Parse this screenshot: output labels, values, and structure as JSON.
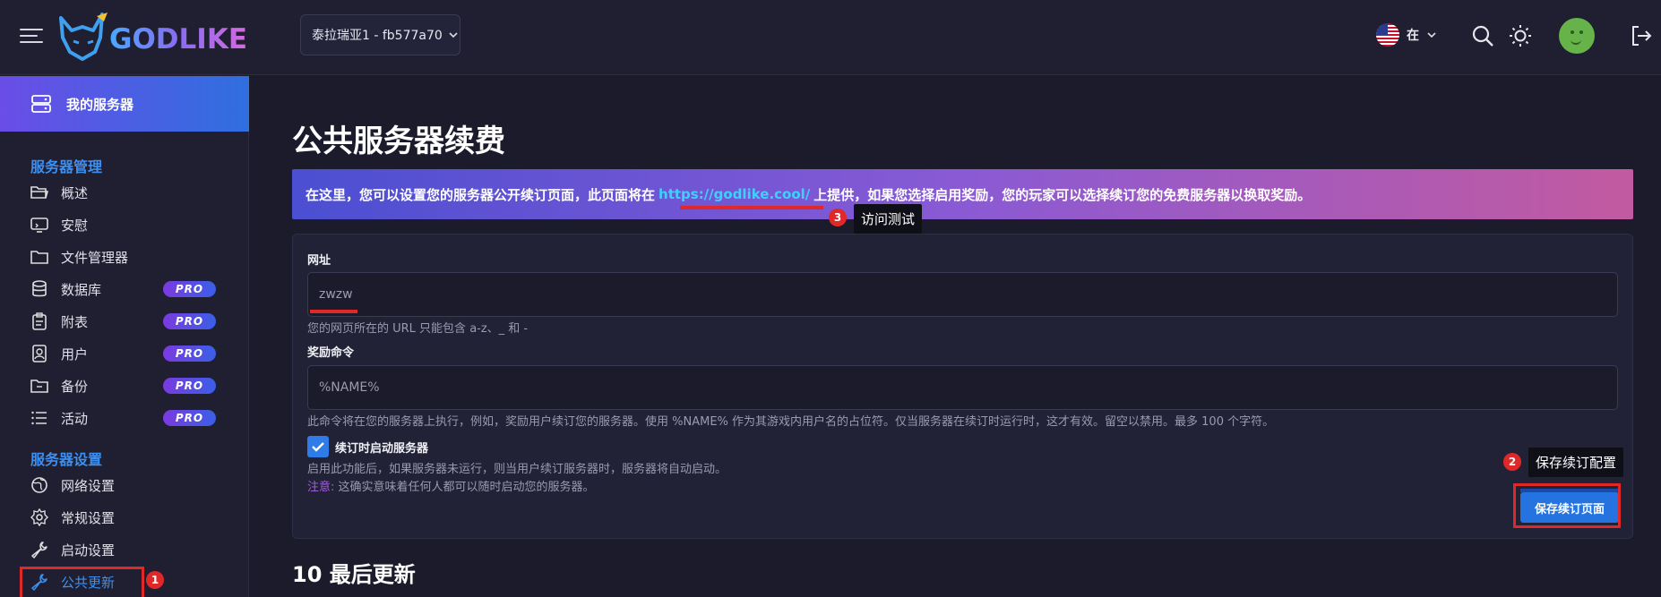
{
  "header": {
    "brand": "GODLIKE",
    "server_selector": "泰拉瑞亚1 - fb577a70",
    "language": "在"
  },
  "sidebar": {
    "my_servers": "我的服务器",
    "management_title": "服务器管理",
    "management_items": [
      {
        "label": "概述",
        "icon": "folder-open-icon",
        "pro": ""
      },
      {
        "label": "安慰",
        "icon": "monitor-icon",
        "pro": ""
      },
      {
        "label": "文件管理器",
        "icon": "folder-icon",
        "pro": ""
      },
      {
        "label": "数据库",
        "icon": "database-icon",
        "pro": "PRO"
      },
      {
        "label": "附表",
        "icon": "clipboard-icon",
        "pro": "PRO"
      },
      {
        "label": "用户",
        "icon": "user-badge-icon",
        "pro": "PRO"
      },
      {
        "label": "备份",
        "icon": "archive-icon",
        "pro": "PRO"
      },
      {
        "label": "活动",
        "icon": "list-icon",
        "pro": "PRO"
      }
    ],
    "settings_title": "服务器设置",
    "settings_items": [
      {
        "label": "网络设置",
        "icon": "globe-icon"
      },
      {
        "label": "常规设置",
        "icon": "gear-icon"
      },
      {
        "label": "启动设置",
        "icon": "wrench-icon"
      },
      {
        "label": "公共更新",
        "icon": "wrench-icon",
        "active": true
      }
    ]
  },
  "main": {
    "title": "公共服务器续费",
    "banner_pre": "在这里，您可以设置您的服务器公开续订页面，此页面将在",
    "banner_link": "https://godlike.cool/",
    "banner_post": "上提供，如果您选择启用奖励，您的玩家可以选择续订您的免费服务器以换取奖励。",
    "url_label": "网址",
    "url_value": "zwzw",
    "url_hint": "您的网页所在的 URL 只能包含 a-z、_ 和 -",
    "reward_label": "奖励命令",
    "reward_placeholder": "%NAME%",
    "reward_hint": "此命令将在您的服务器上执行，例如，奖励用户续订您的服务器。使用 %NAME% 作为其游戏内用户名的占位符。仅当服务器在续订时运行时，这才有效。留空以禁用。最多 100 个字符。",
    "checkbox_label": "续订时启动服务器",
    "checkbox_checked": true,
    "checkbox_hint": "启用此功能后，如果服务器未运行，则当用户续订服务器时，服务器将自动启动。",
    "warn_tag": "注意:",
    "warn_text": "这确实意味着任何人都可以随时启动您的服务器。",
    "save_button": "保存续订页面",
    "section2_title": "10 最后更新"
  },
  "annotations": {
    "badge1": "1",
    "badge2": "2",
    "badge3": "3",
    "tip2": "保存续订配置",
    "tip3": "访问测试"
  },
  "colors": {
    "accent": "#2473e0",
    "annotation": "#e02828",
    "section_title": "#3d8ff0"
  }
}
